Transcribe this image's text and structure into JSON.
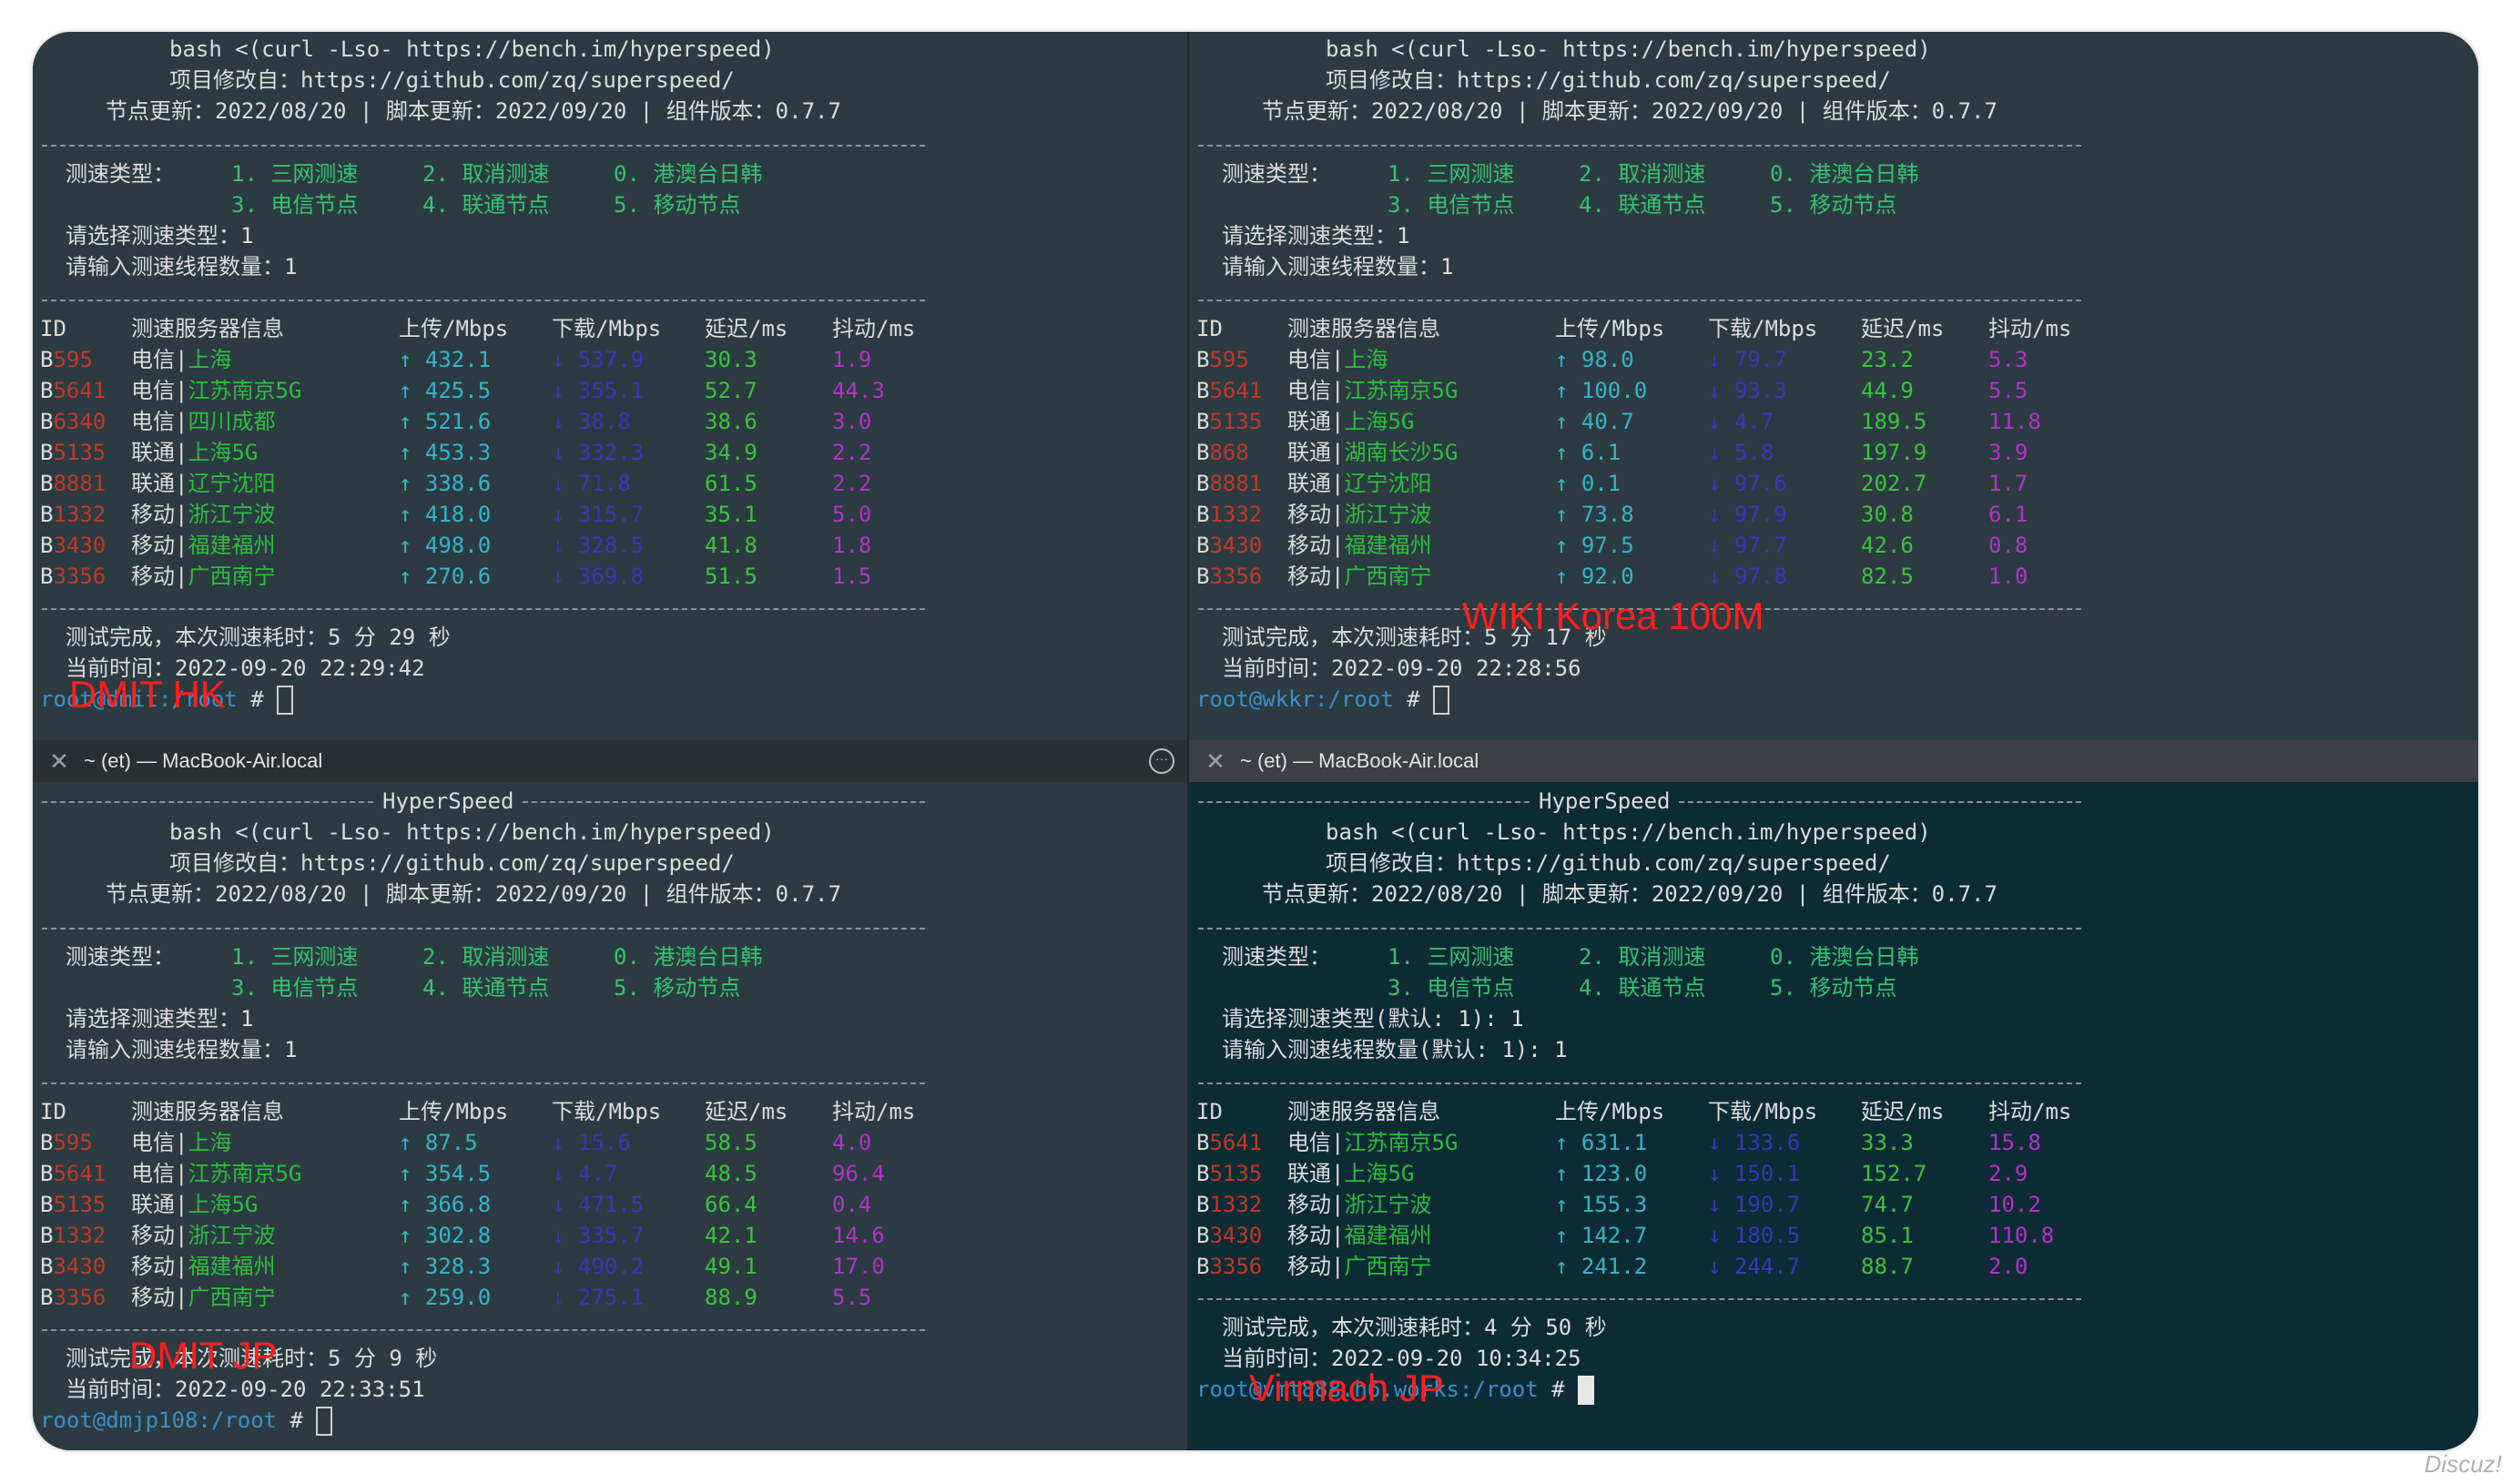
{
  "header": {
    "hyperspeed_title": "HyperSpeed",
    "bash_cmd": "bash <(curl -Lso- https://bench.im/hyperspeed)",
    "project": "项目修改自：https://github.com/zq/superspeed/",
    "updates": "节点更新：2022/08/20 | 脚本更新：2022/09/20 | 组件版本：0.7.7"
  },
  "menu": {
    "label": "测速类型：",
    "opt1": "1. 三网测速",
    "opt2": "2. 取消测速",
    "opt0": "0. 港澳台日韩",
    "opt3": "3. 电信节点",
    "opt4": "4. 联通节点",
    "opt5": "5. 移动节点"
  },
  "table_header": {
    "id": "ID",
    "server": "测速服务器信息",
    "upload": "上传/Mbps",
    "download": "下载/Mbps",
    "latency": "延迟/ms",
    "jitter": "抖动/ms"
  },
  "tabs": {
    "left_title": "~ (et) — MacBook-Air.local",
    "right_title": "~ (et) — MacBook-Air.local"
  },
  "panes": {
    "tl": {
      "select_type": "请选择测速类型：1",
      "threads": "请输入测速线程数量：1",
      "rows": [
        {
          "id": "B595",
          "server": "电信|上海",
          "up": "↑ 432.1",
          "down": "↓ 537.9",
          "lat": "30.3",
          "jit": "1.9"
        },
        {
          "id": "B5641",
          "server": "电信|江苏南京5G",
          "up": "↑ 425.5",
          "down": "↓ 355.1",
          "lat": "52.7",
          "jit": "44.3"
        },
        {
          "id": "B6340",
          "server": "电信|四川成都",
          "up": "↑ 521.6",
          "down": "↓ 38.8",
          "lat": "38.6",
          "jit": "3.0"
        },
        {
          "id": "B5135",
          "server": "联通|上海5G",
          "up": "↑ 453.3",
          "down": "↓ 332.3",
          "lat": "34.9",
          "jit": "2.2"
        },
        {
          "id": "B8881",
          "server": "联通|辽宁沈阳",
          "up": "↑ 338.6",
          "down": "↓ 71.8",
          "lat": "61.5",
          "jit": "2.2"
        },
        {
          "id": "B1332",
          "server": "移动|浙江宁波",
          "up": "↑ 418.0",
          "down": "↓ 315.7",
          "lat": "35.1",
          "jit": "5.0"
        },
        {
          "id": "B3430",
          "server": "移动|福建福州",
          "up": "↑ 498.0",
          "down": "↓ 328.5",
          "lat": "41.8",
          "jit": "1.8"
        },
        {
          "id": "B3356",
          "server": "移动|广西南宁",
          "up": "↑ 270.6",
          "down": "↓ 369.8",
          "lat": "51.5",
          "jit": "1.5"
        }
      ],
      "done": "测试完成，本次测速耗时：5 分 29 秒",
      "time": "当前时间：2022-09-20 22:29:42",
      "prompt_user": "root@dmit:",
      "prompt_path": "/root",
      "prompt_hash": " # ",
      "overlay": "DMIT HK"
    },
    "tr": {
      "select_type": "请选择测速类型：1",
      "threads": "请输入测速线程数量：1",
      "rows": [
        {
          "id": "B595",
          "server": "电信|上海",
          "up": "↑ 98.0",
          "down": "↓ 79.7",
          "lat": "23.2",
          "jit": "5.3"
        },
        {
          "id": "B5641",
          "server": "电信|江苏南京5G",
          "up": "↑ 100.0",
          "down": "↓ 93.3",
          "lat": "44.9",
          "jit": "5.5"
        },
        {
          "id": "B5135",
          "server": "联通|上海5G",
          "up": "↑ 40.7",
          "down": "↓ 4.7",
          "lat": "189.5",
          "jit": "11.8"
        },
        {
          "id": "B868",
          "server": "联通|湖南长沙5G",
          "up": "↑ 6.1",
          "down": "↓ 5.8",
          "lat": "197.9",
          "jit": "3.9"
        },
        {
          "id": "B8881",
          "server": "联通|辽宁沈阳",
          "up": "↑ 0.1",
          "down": "↓ 97.6",
          "lat": "202.7",
          "jit": "1.7"
        },
        {
          "id": "B1332",
          "server": "移动|浙江宁波",
          "up": "↑ 73.8",
          "down": "↓ 97.9",
          "lat": "30.8",
          "jit": "6.1"
        },
        {
          "id": "B3430",
          "server": "移动|福建福州",
          "up": "↑ 97.5",
          "down": "↓ 97.7",
          "lat": "42.6",
          "jit": "0.8"
        },
        {
          "id": "B3356",
          "server": "移动|广西南宁",
          "up": "↑ 92.0",
          "down": "↓ 97.8",
          "lat": "82.5",
          "jit": "1.0"
        }
      ],
      "done": "测试完成，本次测速耗时：5 分 17 秒",
      "time": "当前时间：2022-09-20 22:28:56",
      "prompt_user": "root@wkkr:",
      "prompt_path": "/root",
      "prompt_hash": " # ",
      "overlay": "WIKI Korea 100M"
    },
    "bl": {
      "select_type": "请选择测速类型：1",
      "threads": "请输入测速线程数量：1",
      "rows": [
        {
          "id": "B595",
          "server": "电信|上海",
          "up": "↑ 87.5",
          "down": "↓ 15.6",
          "lat": "58.5",
          "jit": "4.0"
        },
        {
          "id": "B5641",
          "server": "电信|江苏南京5G",
          "up": "↑ 354.5",
          "down": "↓ 4.7",
          "lat": "48.5",
          "jit": "96.4"
        },
        {
          "id": "B5135",
          "server": "联通|上海5G",
          "up": "↑ 366.8",
          "down": "↓ 471.5",
          "lat": "66.4",
          "jit": "0.4"
        },
        {
          "id": "B1332",
          "server": "移动|浙江宁波",
          "up": "↑ 302.8",
          "down": "↓ 335.7",
          "lat": "42.1",
          "jit": "14.6"
        },
        {
          "id": "B3430",
          "server": "移动|福建福州",
          "up": "↑ 328.3",
          "down": "↓ 490.2",
          "lat": "49.1",
          "jit": "17.0"
        },
        {
          "id": "B3356",
          "server": "移动|广西南宁",
          "up": "↑ 259.0",
          "down": "↓ 275.1",
          "lat": "88.9",
          "jit": "5.5"
        }
      ],
      "done": "测试完成，本次测速耗时：5 分 9 秒",
      "time": "当前时间：2022-09-20 22:33:51",
      "prompt_user": "root@dmjp108:",
      "prompt_path": "/root",
      "prompt_hash": " # ",
      "overlay": "DMIT JP"
    },
    "br": {
      "select_type": "请选择测速类型(默认: 1): 1",
      "threads": "请输入测速线程数量(默认: 1): 1",
      "rows": [
        {
          "id": "B5641",
          "server": "电信|江苏南京5G",
          "up": "↑ 631.1",
          "down": "↓ 133.6",
          "lat": "33.3",
          "jit": "15.8"
        },
        {
          "id": "B5135",
          "server": "联通|上海5G",
          "up": "↑ 123.0",
          "down": "↓ 150.1",
          "lat": "152.7",
          "jit": "2.9"
        },
        {
          "id": "B1332",
          "server": "移动|浙江宁波",
          "up": "↑ 155.3",
          "down": "↓ 190.7",
          "lat": "74.7",
          "jit": "10.2"
        },
        {
          "id": "B3430",
          "server": "移动|福建福州",
          "up": "↑ 142.7",
          "down": "↓ 180.5",
          "lat": "85.1",
          "jit": "110.8"
        },
        {
          "id": "B3356",
          "server": "移动|广西南宁",
          "up": "↑ 241.2",
          "down": "↓ 244.7",
          "lat": "88.7",
          "jit": "2.0"
        }
      ],
      "done": "测试完成，本次测速耗时：4 分 50 秒",
      "time": "当前时间：2022-09-20 10:34:25",
      "prompt_user": "root@vmt888.h6.works:",
      "prompt_path": "/root",
      "prompt_hash": " # ",
      "overlay": "Virmach JP"
    }
  },
  "watermark": "Discuz!"
}
